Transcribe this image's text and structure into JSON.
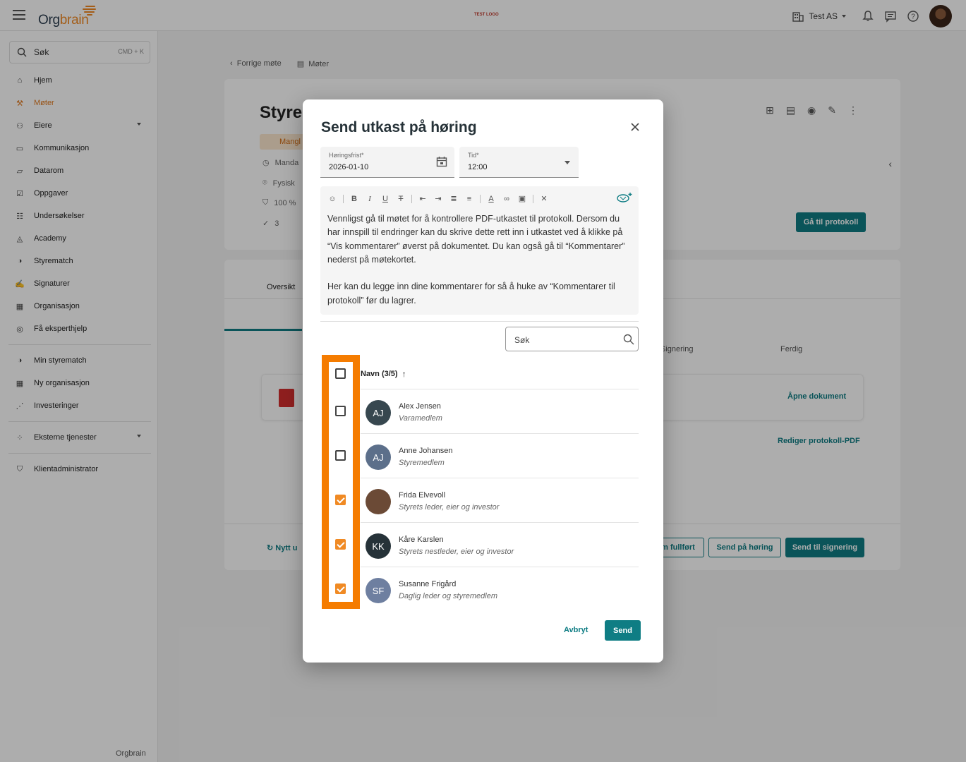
{
  "topbar": {
    "logo_text_a": "Org",
    "logo_text_b": "brain",
    "test_logo": "TEST LOGO",
    "org_name": "Test AS"
  },
  "sidebar": {
    "search_label": "Søk",
    "search_shortcut": "CMD + K",
    "items": [
      {
        "label": "Hjem",
        "icon": "home-icon"
      },
      {
        "label": "Møter",
        "icon": "gavel-icon",
        "active": true
      },
      {
        "label": "Eiere",
        "icon": "people-icon",
        "expandable": true
      },
      {
        "label": "Kommunikasjon",
        "icon": "chat-icon"
      },
      {
        "label": "Datarom",
        "icon": "folder-icon"
      },
      {
        "label": "Oppgaver",
        "icon": "task-icon"
      },
      {
        "label": "Undersøkelser",
        "icon": "survey-icon"
      },
      {
        "label": "Academy",
        "icon": "graduation-icon"
      },
      {
        "label": "Styrematch",
        "icon": "match-icon"
      },
      {
        "label": "Signaturer",
        "icon": "signature-icon"
      },
      {
        "label": "Organisasjon",
        "icon": "building-icon"
      },
      {
        "label": "Få eksperthjelp",
        "icon": "expert-icon"
      }
    ],
    "items2": [
      {
        "label": "Min styrematch",
        "icon": "match-icon"
      },
      {
        "label": "Ny organisasjon",
        "icon": "building-add-icon"
      },
      {
        "label": "Investeringer",
        "icon": "chart-icon"
      }
    ],
    "items3": [
      {
        "label": "Eksterne tjenester",
        "icon": "services-icon",
        "expandable": true
      }
    ],
    "items4": [
      {
        "label": "Klientadministrator",
        "icon": "shield-icon"
      }
    ],
    "footer_logo": "Orgbrain"
  },
  "main": {
    "breadcrumb_prev": "Forrige møte",
    "breadcrumb_meetings": "Møter",
    "title": "Styrer",
    "warning_badge": "Mangl",
    "meta_date": "Manda",
    "meta_place": "Fysisk",
    "meta_percent": "100 %",
    "meta_count": "3",
    "goto_protocol": "Gå til protokoll",
    "tab_overview": "Oversikt",
    "step_signing": "Signering",
    "step_done": "Ferdig",
    "open_document": "Åpne dokument",
    "edit_protocol_pdf": "Rediger protokoll-PDF",
    "new_upload": "Nytt u",
    "mark_complete": "m fullført",
    "send_hearing": "Send på høring",
    "send_signing": "Send til signering"
  },
  "modal": {
    "title": "Send utkast på høring",
    "deadline_label": "Høringsfrist*",
    "deadline_value": "2026-01-10",
    "time_label": "Tid*",
    "time_value": "12:00",
    "body_p1": "Vennligst gå til møtet for å kontrollere PDF-utkastet til protokoll. Dersom du har innspill til endringer kan du skrive dette rett inn i utkastet ved å klikke på “Vis kommentarer” øverst på dokumentet. Du kan også gå til “Kommentarer” nederst på møtekortet.",
    "body_p2": "Her kan du legge inn dine kommentarer for så å huke av “Kommentarer til protokoll” før du lagrer.",
    "search_placeholder": "Søk",
    "column_name": "Navn (3/5)",
    "people": [
      {
        "initials": "AJ",
        "name": "Alex Jensen",
        "role": "Varamedlem",
        "checked": false,
        "color": "#37474f"
      },
      {
        "initials": "AJ",
        "name": "Anne Johansen",
        "role": "Styremedlem",
        "checked": false,
        "color": "#5c6f8a"
      },
      {
        "initials": "",
        "name": "Frida Elvevoll",
        "role": "Styrets leder, eier og investor",
        "checked": true,
        "color": "#6b4a36"
      },
      {
        "initials": "KK",
        "name": "Kåre Karslen",
        "role": "Styrets nestleder, eier og investor",
        "checked": true,
        "color": "#263238"
      },
      {
        "initials": "SF",
        "name": "Susanne Frigård",
        "role": "Daglig leder og styremedlem",
        "checked": true,
        "color": "#6e7fa0"
      }
    ],
    "cancel_label": "Avbryt",
    "send_label": "Send"
  },
  "colors": {
    "accent_teal": "#0f7d84",
    "brand_orange": "#f08a24",
    "highlight_orange": "#f57c00"
  }
}
